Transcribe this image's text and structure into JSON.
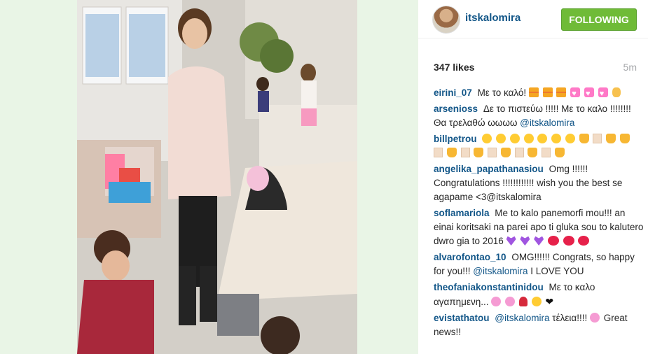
{
  "post": {
    "username": "itskalomira",
    "follow_label": "FOLLOWING",
    "likes": "347 likes",
    "time": "5m"
  },
  "comments": [
    {
      "user": "eirini_07",
      "text": "Με το καλό!"
    },
    {
      "user": "arsenioss",
      "text": "Δε το πιστεύω !!!!! Με το καλο !!!!!!!! Θα τρελαθώ ωωωω",
      "mention": "@itskalomira"
    },
    {
      "user": "billpetrou",
      "text": ""
    },
    {
      "user": "angelika_papathanasiou",
      "text": "Omg !!!!!! Congratulations !!!!!!!!!!!! wish you the best se agapame <3@itskalomira"
    },
    {
      "user": "soflamariola",
      "text": "Me to kalo panemorfi mou!!! an einai koritsaki na parei apo ti gluka sou to kalutero dwro gia to 2016"
    },
    {
      "user": "alvarofontao_10",
      "text": "OMG!!!!!! Congrats, so happy for you!!!",
      "mention": "@itskalomira",
      "text2": "I LOVE YOU"
    },
    {
      "user": "theofaniakonstantinidou",
      "text": "Με το καλο αγαπημενη..."
    },
    {
      "user": "evistathatou",
      "mention": "@itskalomira",
      "text": "τέλεια!!!!",
      "text2": "Great news!!"
    }
  ],
  "icons": [
    "gift-icon",
    "heart-icon",
    "face-icon",
    "prayer-hands-icon",
    "clapping-hands-icon",
    "purple-heart-icon",
    "kiss-lips-icon",
    "rose-icon",
    "heart-black-icon"
  ]
}
